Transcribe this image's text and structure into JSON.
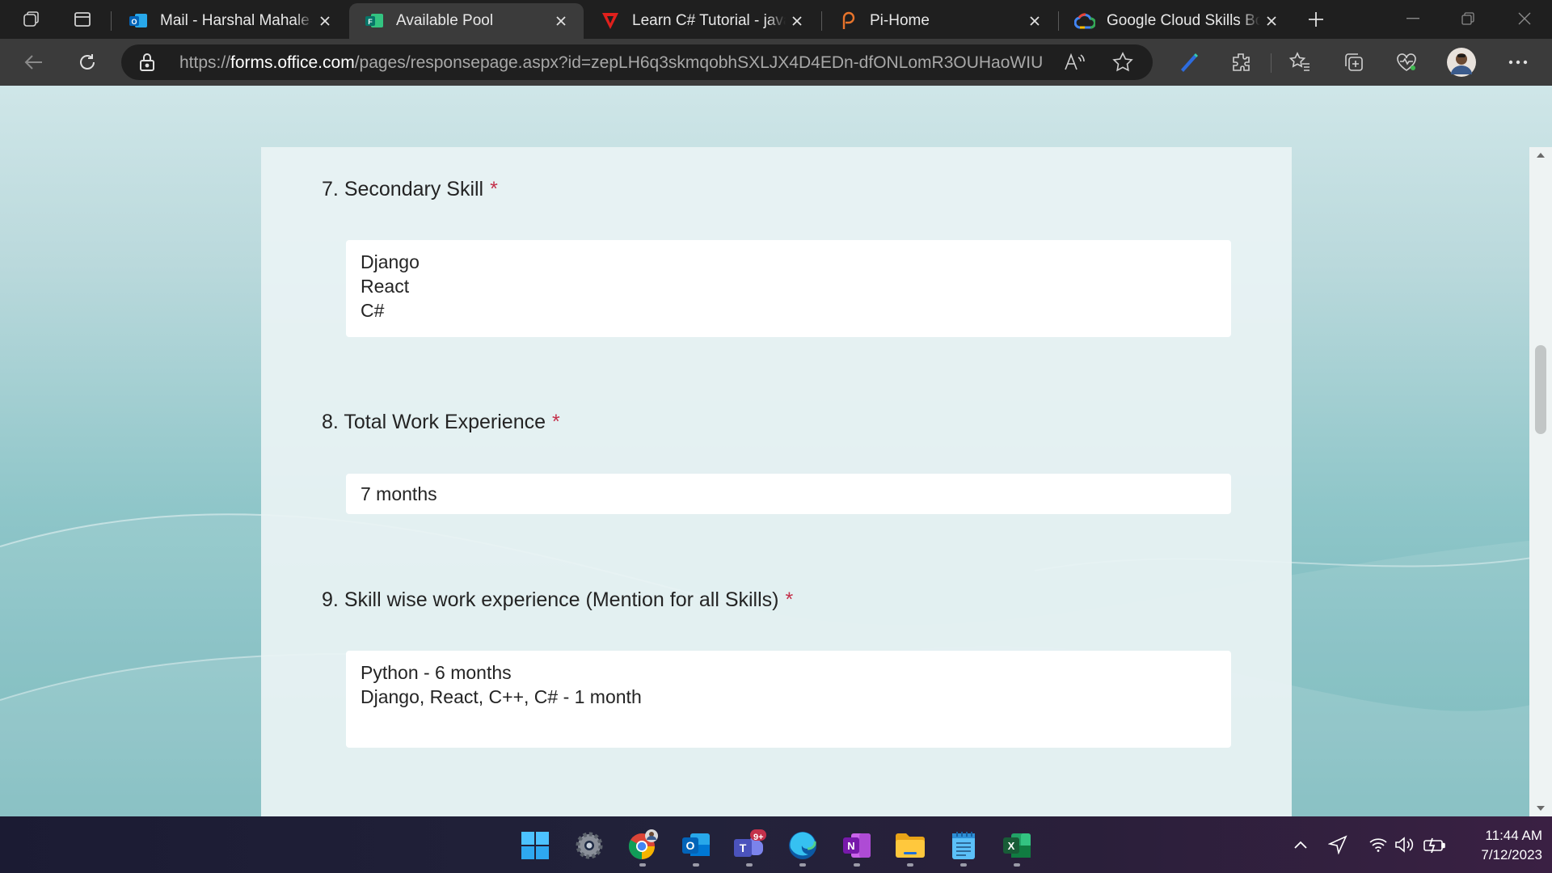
{
  "browser": {
    "tabs": [
      {
        "title": "Mail - Harshal Mahale - Outlook",
        "icon": "outlook-icon",
        "active": false
      },
      {
        "title": "Available Pool",
        "icon": "forms-icon",
        "active": true
      },
      {
        "title": "Learn C# Tutorial - javatpoint",
        "icon": "javatpoint-icon",
        "active": false
      },
      {
        "title": "Pi-Home",
        "icon": "pi-icon",
        "active": false
      },
      {
        "title": "Google Cloud Skills Boost",
        "icon": "google-cloud-icon",
        "active": false
      }
    ],
    "address": {
      "prefix": "https://",
      "host": "forms.office.com",
      "path": "/pages/responsepage.aspx?id=zepLH6q3skmqobhSXLJX4D4EDn-dfONLomR3OUHaoWIU..."
    }
  },
  "form": {
    "questions": [
      {
        "number": "7.",
        "title": "Secondary Skill",
        "required_mark": "*",
        "answer_lines": [
          "Django",
          "React",
          "C#"
        ]
      },
      {
        "number": "8.",
        "title": "Total Work Experience",
        "required_mark": "*",
        "answer_lines": [
          "7 months"
        ]
      },
      {
        "number": "9.",
        "title": "Skill wise work experience (Mention for all Skills)",
        "required_mark": "*",
        "answer_lines": [
          "Python - 6 months",
          "Django, React, C++, C# - 1 month"
        ]
      }
    ]
  },
  "taskbar": {
    "apps": [
      "windows-start-icon",
      "settings-icon",
      "chrome-icon",
      "outlook-icon",
      "teams-icon",
      "edge-icon",
      "onenote-icon",
      "file-explorer-icon",
      "notepad-icon",
      "excel-icon"
    ],
    "teams_badge": "9+",
    "clock": {
      "time": "11:44 AM",
      "date": "7/12/2023"
    }
  },
  "colors": {
    "required": "#c4314b",
    "active_tab": "#3b3b3b",
    "tab_strip": "#1f1f1f"
  }
}
